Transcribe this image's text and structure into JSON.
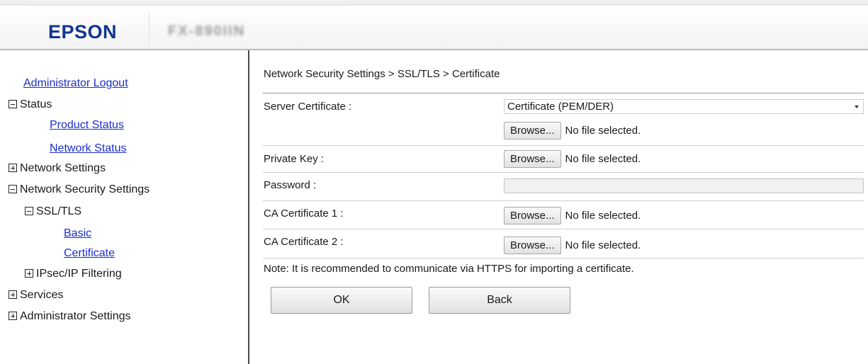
{
  "header": {
    "brand": "EPSON",
    "model": "FX-890IIN"
  },
  "sidebar": {
    "administrator_logout": "Administrator Logout",
    "status": "Status",
    "product_status": "Product Status",
    "network_status": "Network Status",
    "network_settings": "Network Settings",
    "network_security_settings": "Network Security Settings",
    "ssl_tls": "SSL/TLS",
    "basic": "Basic",
    "certificate": "Certificate",
    "ipsec_ip_filtering": "IPsec/IP Filtering",
    "services": "Services",
    "administrator_settings": "Administrator Settings"
  },
  "main": {
    "breadcrumb": "Network Security Settings > SSL/TLS > Certificate",
    "fields": {
      "server_certificate": {
        "label": "Server Certificate :",
        "format_selected": "Certificate (PEM/DER)",
        "browse_label": "Browse...",
        "file_status": "No file selected."
      },
      "private_key": {
        "label": "Private Key :",
        "browse_label": "Browse...",
        "file_status": "No file selected."
      },
      "password": {
        "label": "Password :",
        "value": ""
      },
      "ca_certificate_1": {
        "label": "CA Certificate 1 :",
        "browse_label": "Browse...",
        "file_status": "No file selected."
      },
      "ca_certificate_2": {
        "label": "CA Certificate 2 :",
        "browse_label": "Browse...",
        "file_status": "No file selected."
      }
    },
    "note": "Note: It is recommended to communicate via HTTPS for importing a certificate.",
    "ok_label": "OK",
    "back_label": "Back"
  }
}
